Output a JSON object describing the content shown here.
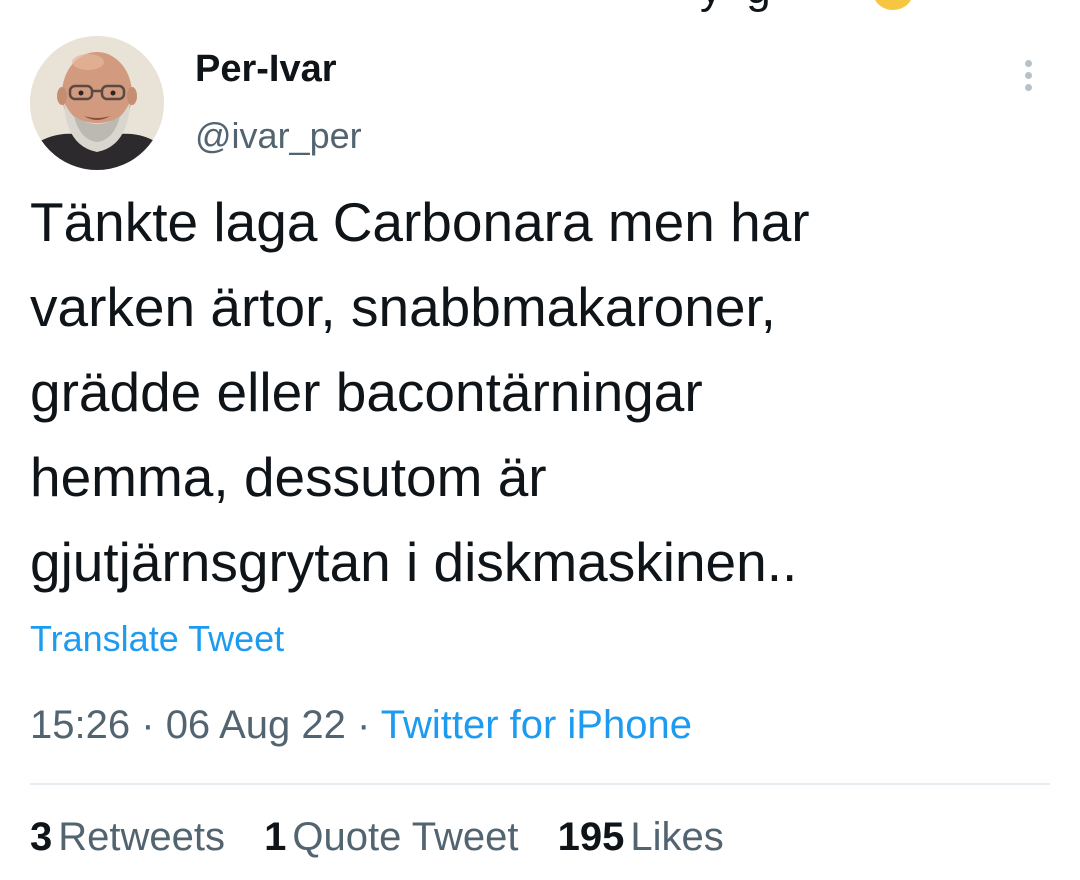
{
  "tweet": {
    "author": {
      "display_name": "Per-Ivar",
      "handle": "@ivar_per"
    },
    "text_lines": [
      "Tänkte laga Carbonara men har",
      "varken ärtor, snabbmakaroner,",
      "grädde eller bacontärningar",
      "hemma, dessutom är",
      "gjutjärnsgrytan i diskmaskinen.."
    ],
    "translate_label": "Translate Tweet",
    "time": "15:26",
    "date": "06 Aug 22",
    "separator": "·",
    "source": "Twitter for iPhone",
    "stats": {
      "retweets": {
        "count": "3",
        "label": "Retweets"
      },
      "quote_tweets": {
        "count": "1",
        "label": "Quote Tweet"
      },
      "likes": {
        "count": "195",
        "label": "Likes"
      }
    },
    "icons": {
      "more": "more-vertical-icon"
    }
  },
  "colors": {
    "text_primary": "#0f1419",
    "text_secondary": "#536471",
    "link_blue": "#1d9bf0",
    "divider": "#e6ecf0"
  }
}
